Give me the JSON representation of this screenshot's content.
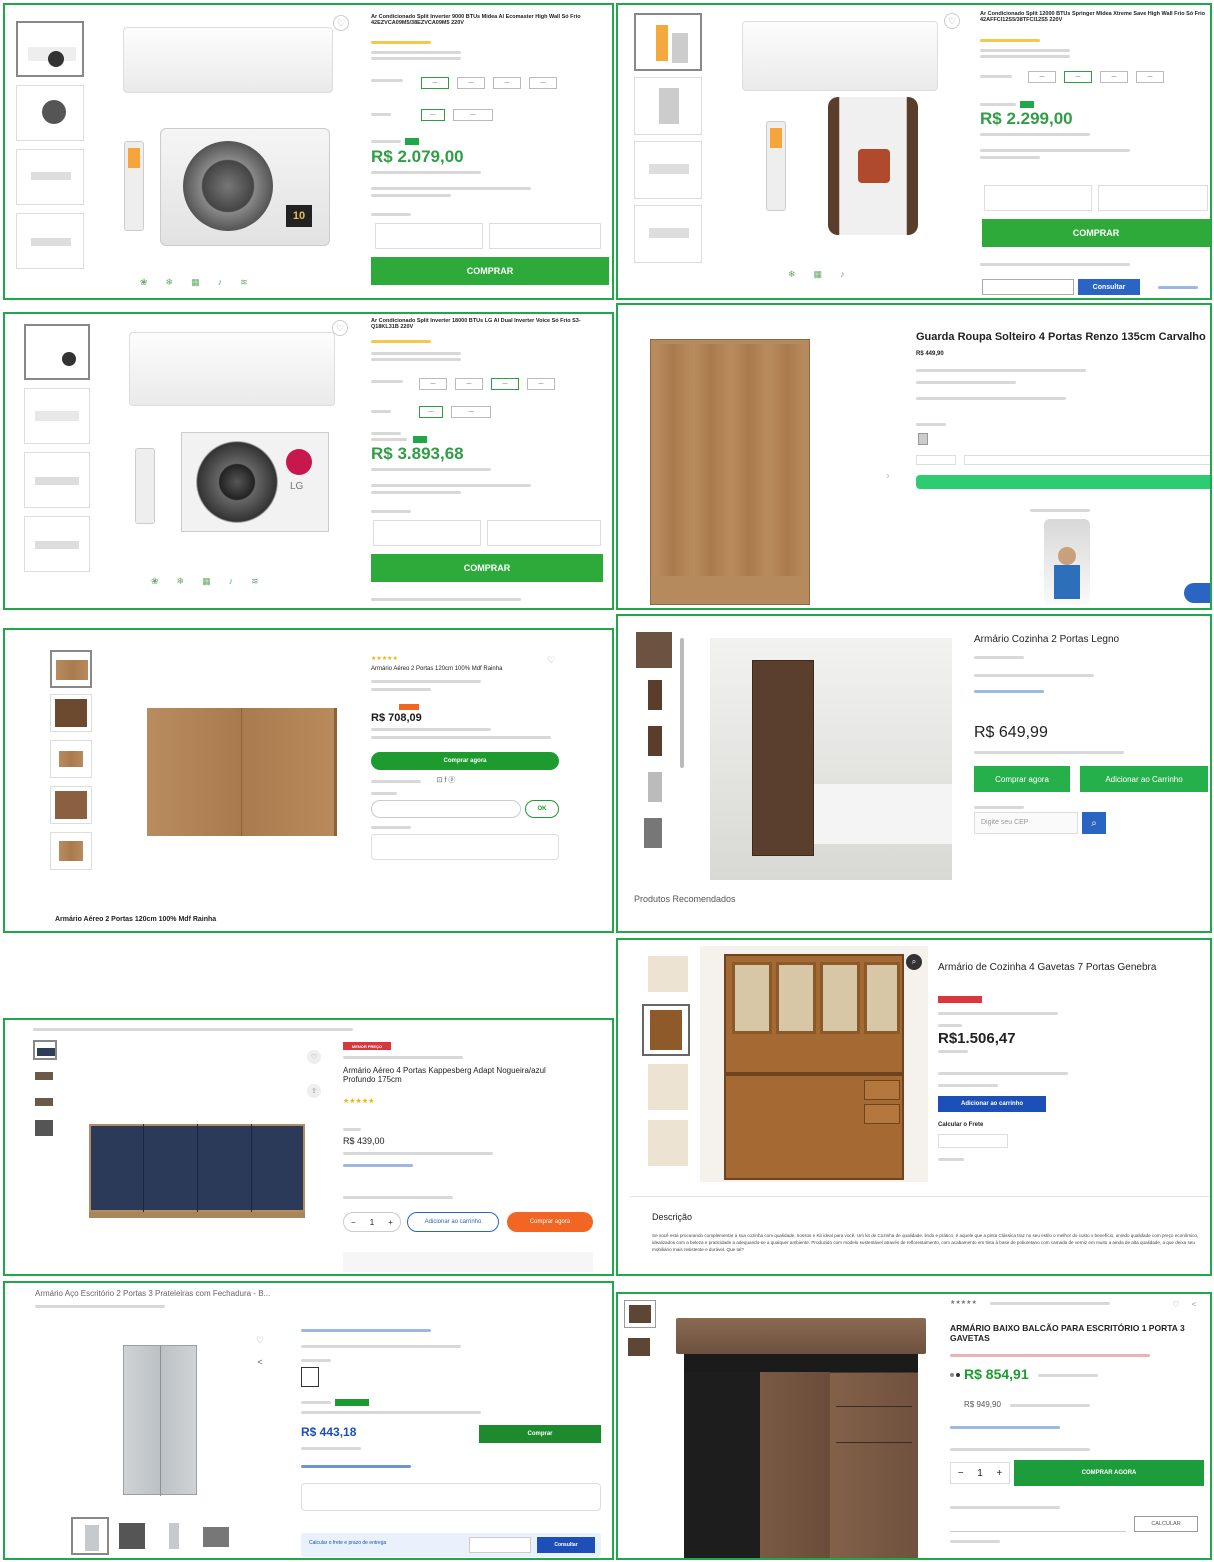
{
  "ac1": {
    "title": "Ar Condicionado Split Inverter 9000 BTUs Midea AI Ecomaster High Wall Só Frio 42EZVCA09M5/38EZVCA09M5 220V",
    "price": "R$ 2.079,00",
    "buy": "COMPRAR",
    "badge": "10"
  },
  "ac2": {
    "title": "Ar Condicionado Split 12000 BTUs Springer Midea Xtreme Save High Wall Frio Só Frio 42AFFCI12S5/38TFCI12S5 220V",
    "price": "R$ 2.299,00",
    "buy": "COMPRAR",
    "consult": "Consultar"
  },
  "ac3": {
    "title": "Ar Condicionado Split Inverter 18000 BTUs LG AI Dual Inverter Voice Só Frio S3-Q18KL31B 220V",
    "price": "R$ 3.893,68",
    "buy": "COMPRAR",
    "brand": "LG"
  },
  "wardrobe": {
    "title": "Guarda Roupa Solteiro 4 Portas Renzo 135cm Carvalho",
    "price": "R$ 449,90"
  },
  "aereo2": {
    "title": "Armário Aéreo 2 Portas 120cm 100% Mdf Rainha",
    "price": "R$ 708,09",
    "buy": "Comprar agora",
    "ok": "OK",
    "bottom_title": "Armário Aéreo 2 Portas 120cm 100% Mdf Rainha"
  },
  "legno": {
    "title": "Armário Cozinha 2 Portas Legno",
    "price": "R$ 649,99",
    "buy": "Comprar agora",
    "add": "Adicionar ao Carrinho",
    "cep_placeholder": "Digite seu CEP",
    "recommended": "Produtos Recomendados"
  },
  "genebra": {
    "title": "Armário de Cozinha 4 Gavetas 7 Portas Genebra",
    "price": "R$1.506,47",
    "add": "Adicionar ao carrinho",
    "calc": "Calcular o Frete",
    "desc_heading": "Descrição",
    "desc_text": "Se você está procurando complementar a sua cozinha com qualidade, nossos e Kit ideal para você. Um kit de Cozinha de qualidade, lindo e prático, é aquele que a pinta Clássica traz no seu estilo o melhor do custo x benefício, unindo qualidade com preço econômico, idealizados com a beleza e praticidade a adequando-se a qualquer ambiente. Produzido com modelo sustentável através de reflorestamento, com acabamento em tinta à base de poliuretano com camada de verniz em muito a ainda de alta qualidade, a que deixa seu mobiliário mais resistente e durável. Que tal?"
  },
  "kappes": {
    "title": "Armário Aéreo 4 Portas Kappesberg Adapt Nogueira/azul Profundo 175cm",
    "tag": "MENOR PREÇO",
    "price": "R$ 439,00",
    "add": "Adicionar ao carrinho",
    "buy": "Comprar agora",
    "qty": "1"
  },
  "office": {
    "title": "Armário Aço Escritório 2 Portas 3 Prateleiras com Fechadura - B...",
    "price": "R$ 443,18",
    "buy": "Comprar",
    "calc": "Calcular o frete e prazo de entrega",
    "consult": "Consultar"
  },
  "balcao": {
    "title": "ARMÁRIO BAIXO BALCÃO PARA ESCRITÓRIO 1 PORTA 3 GAVETAS",
    "price": "R$ 854,91",
    "old": "R$ 949,90",
    "buy": "COMPRAR AGORA",
    "calc": "CALCULAR",
    "qty": "1"
  },
  "colors": {
    "green": "#1fa84a",
    "blue": "#2a65c4",
    "orange": "#f26522"
  }
}
